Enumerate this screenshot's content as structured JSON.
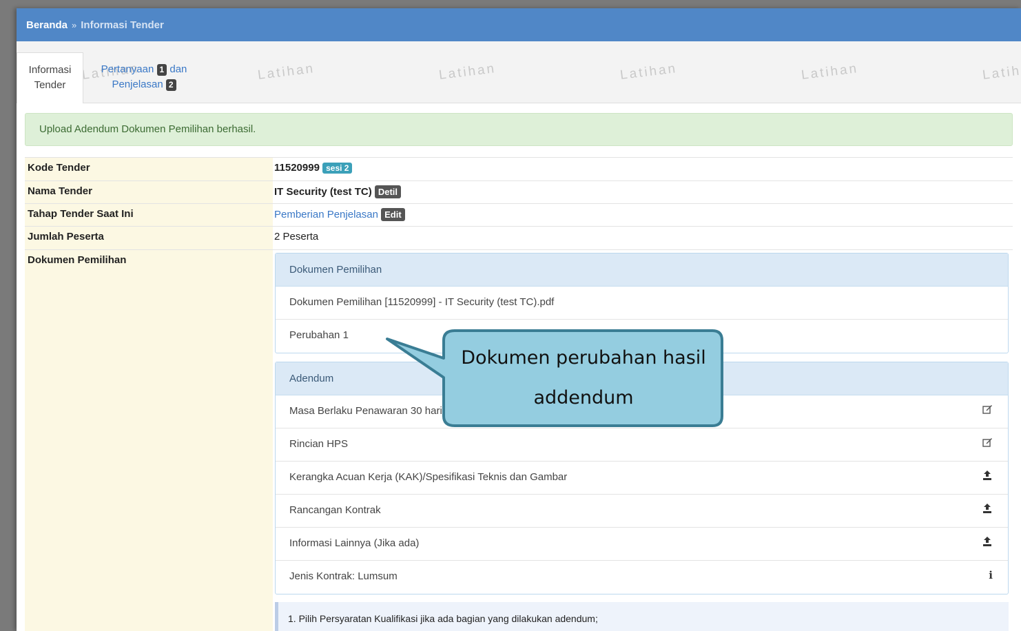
{
  "breadcrumb": {
    "home": "Beranda",
    "separator": "»",
    "current": "Informasi Tender"
  },
  "tabs": {
    "active": {
      "line1": "Informasi",
      "line2": "Tender"
    },
    "questions": {
      "word1": "Pertanyaan",
      "count1": "1",
      "word2": "dan",
      "word3": "Penjelasan",
      "count2": "2"
    }
  },
  "watermark": "Latihan",
  "alert": "Upload Adendum Dokumen Pemilihan berhasil.",
  "info": {
    "kode_label": "Kode Tender",
    "kode_value": "11520999",
    "kode_badge": "sesi 2",
    "nama_label": "Nama Tender",
    "nama_value": "IT Security (test TC)",
    "nama_badge": "Detil",
    "tahap_label": "Tahap Tender Saat Ini",
    "tahap_value": "Pemberian Penjelasan",
    "tahap_badge": "Edit",
    "jumlah_label": "Jumlah Peserta",
    "jumlah_value": "2 Peserta",
    "dokumen_label": "Dokumen Pemilihan"
  },
  "dokumen_panel": {
    "title": "Dokumen Pemilihan",
    "items": [
      "Dokumen Pemilihan [11520999] - IT Security (test TC).pdf",
      "Perubahan 1"
    ]
  },
  "adendum_panel": {
    "title": "Adendum",
    "items": [
      {
        "label": "Masa Berlaku Penawaran 30 hari",
        "icon": "edit-icon"
      },
      {
        "label": "Rincian HPS",
        "icon": "edit-icon"
      },
      {
        "label": "Kerangka Acuan Kerja (KAK)/Spesifikasi Teknis dan Gambar",
        "icon": "upload-icon"
      },
      {
        "label": "Rancangan Kontrak",
        "icon": "upload-icon"
      },
      {
        "label": "Informasi Lainnya (Jika ada)",
        "icon": "upload-icon"
      },
      {
        "label": "Jenis Kontrak: Lumsum",
        "icon": "info-icon"
      }
    ]
  },
  "note": "1. Pilih Persyaratan Kualifikasi jika ada bagian yang dilakukan adendum;",
  "callout": {
    "line1": "Dokumen perubahan hasil",
    "line2": "addendum",
    "fill": "#94cde0",
    "border": "#3a7d94"
  }
}
